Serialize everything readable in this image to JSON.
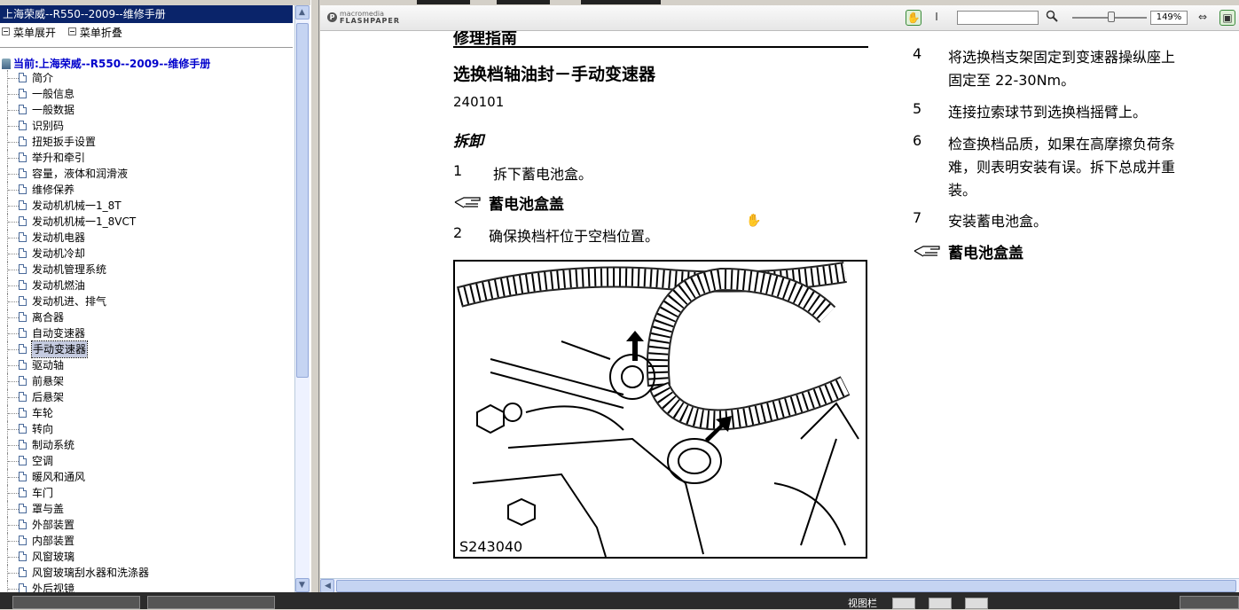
{
  "tree": {
    "window_title": "上海荣威--R550--2009--维修手册",
    "menu": {
      "expand": "菜单展开",
      "collapse": "菜单折叠"
    },
    "current": "当前:上海荣威--R550--2009--维修手册",
    "items": [
      "简介",
      "一般信息",
      "一般数据",
      "识别码",
      "扭矩扳手设置",
      "举升和牵引",
      "容量，液体和润滑液",
      "维修保养",
      "发动机机械一1_8T",
      "发动机机械一1_8VCT",
      "发动机电器",
      "发动机冷却",
      "发动机管理系统",
      "发动机燃油",
      "发动机进、排气",
      "离合器",
      "自动变速器",
      "手动变速器",
      "驱动轴",
      "前悬架",
      "后悬架",
      "车轮",
      "转向",
      "制动系统",
      "空调",
      "暖风和通风",
      "车门",
      "罩与盖",
      "外部装置",
      "内部装置",
      "风窗玻璃",
      "风窗玻璃刮水器和洗涤器",
      "外后视镜"
    ],
    "selected_index": 17
  },
  "toolbar": {
    "logo_line1": "macromedia",
    "logo_line2": "FLASHPAPER",
    "zoom": "149%"
  },
  "document": {
    "chapter": "修理指南",
    "heading": "选换档轴油封－手动变速器",
    "code": "240101",
    "removal": "拆卸",
    "left_steps": [
      {
        "num": "1",
        "text": "拆下蓄电池盒。"
      },
      {
        "num": "2",
        "text": "确保换档杆位于空档位置。"
      }
    ],
    "ref1": "蓄电池盒盖",
    "figure_label": "S243040",
    "right_steps": [
      {
        "num": "4",
        "line1": "将选换档支架固定到变速器操纵座上",
        "line2": "固定至 22-30Nm。"
      },
      {
        "num": "5",
        "line1": "连接拉索球节到选换档摇臂上。"
      },
      {
        "num": "6",
        "line1": "检查换档品质，如果在高摩擦负荷条",
        "line2": "难，则表明安装有误。拆下总成并重",
        "line3": "装。"
      },
      {
        "num": "7",
        "line1": "安装蓄电池盒。"
      }
    ],
    "ref2": "蓄电池盒盖"
  },
  "taskbar": {
    "view_label": "视图栏"
  }
}
